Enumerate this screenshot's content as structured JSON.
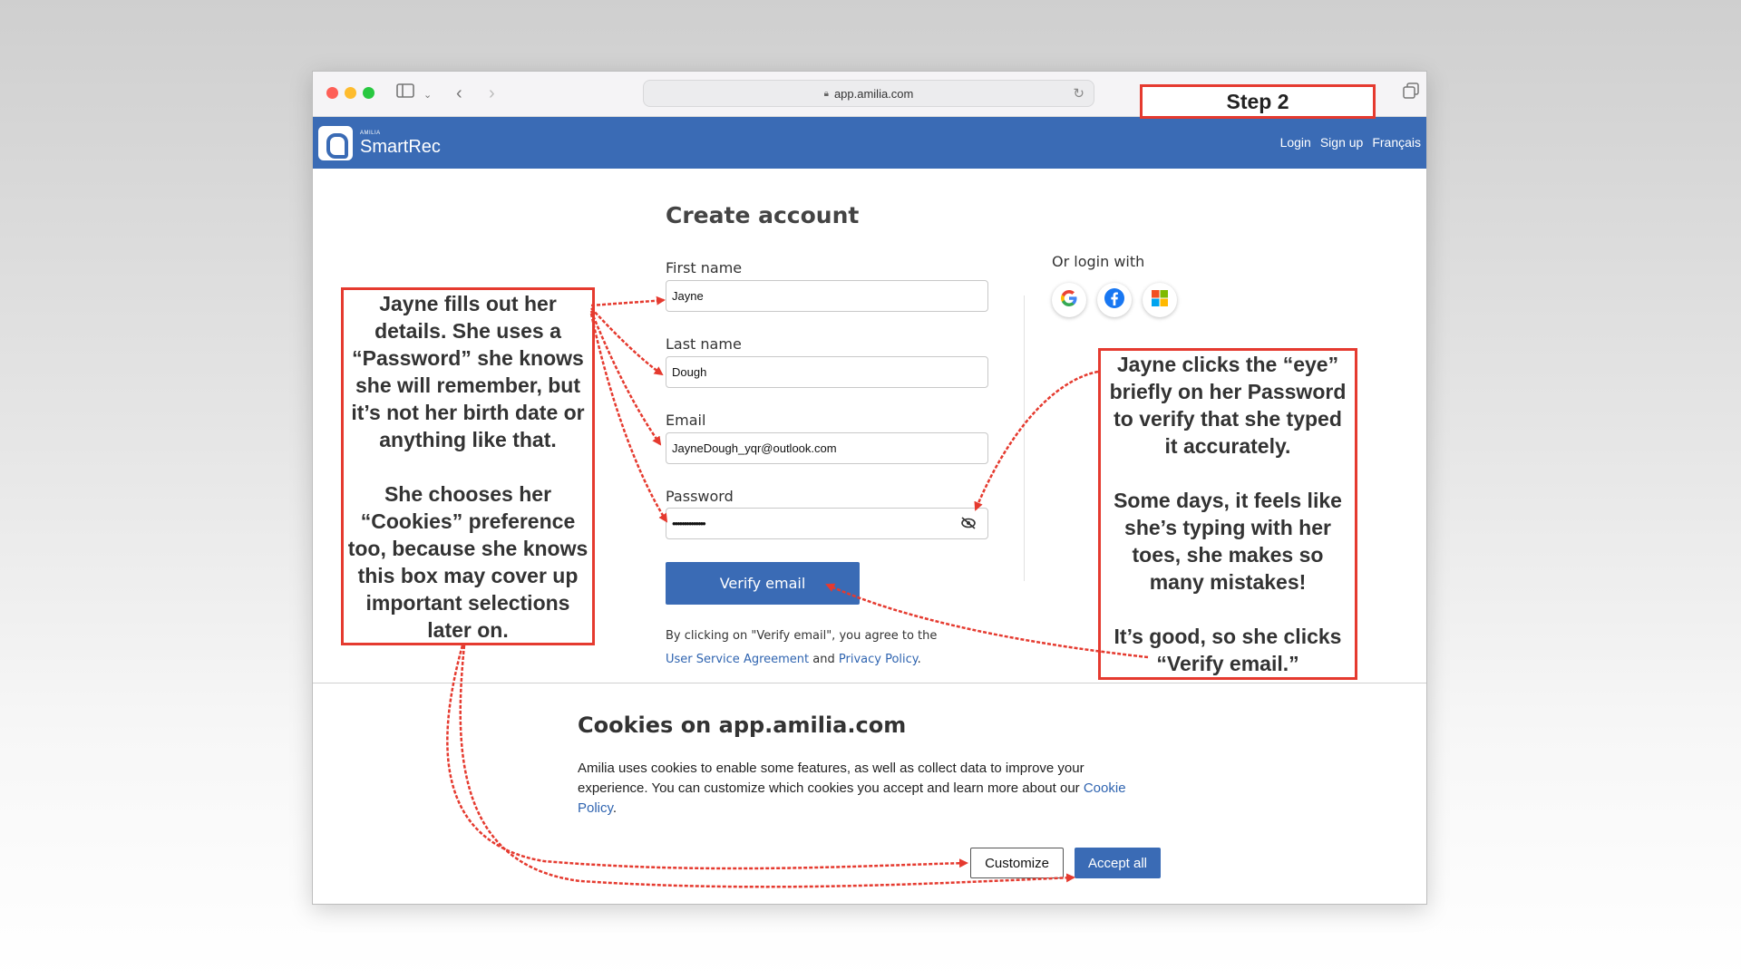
{
  "browser": {
    "url": "app.amilia.com"
  },
  "app": {
    "logo_small": "AMILIA",
    "logo_name": "SmartRec",
    "nav": {
      "login": "Login",
      "signup": "Sign up",
      "language": "Français"
    }
  },
  "form": {
    "title": "Create account",
    "first_name_label": "First name",
    "first_name_value": "Jayne",
    "last_name_label": "Last name",
    "last_name_value": "Dough",
    "email_label": "Email",
    "email_value": "JayneDough_yqr@outlook.com",
    "password_label": "Password",
    "password_value": "••••••••••••••",
    "verify_button": "Verify email",
    "agree_prefix": "By clicking on \"Verify email\", you agree to the ",
    "agree_link1": "User Service Agreement",
    "agree_and": " and ",
    "agree_link2": "Privacy Policy",
    "agree_suffix": "."
  },
  "social": {
    "label": "Or login with",
    "providers": [
      "google-icon",
      "facebook-icon",
      "microsoft-icon"
    ]
  },
  "cookies": {
    "title": "Cookies on app.amilia.com",
    "text": "Amilia uses cookies to enable some features, as well as collect data to improve your experience. You can customize which cookies you accept and learn more about our ",
    "policy_link": "Cookie Policy",
    "period": ".",
    "customize_button": "Customize",
    "accept_button": "Accept all"
  },
  "annotations": {
    "step": "Step 2",
    "left_p1": "Jayne fills out her details. She uses a “Password” she knows she will remember, but it’s not her birth date or anything like that.",
    "left_p2": "She chooses her “Cookies” preference too, because she knows this box may cover up important selections later on.",
    "right_p1": "Jayne clicks the “eye” briefly on her Password to verify that she typed it accurately.",
    "right_p2": "Some days, it feels like she’s typing with her toes, she makes so many mistakes!",
    "right_p3": "It’s good, so she clicks “Verify email.”"
  },
  "colors": {
    "brand": "#3a6bb5",
    "annotation": "#e53a2f"
  }
}
